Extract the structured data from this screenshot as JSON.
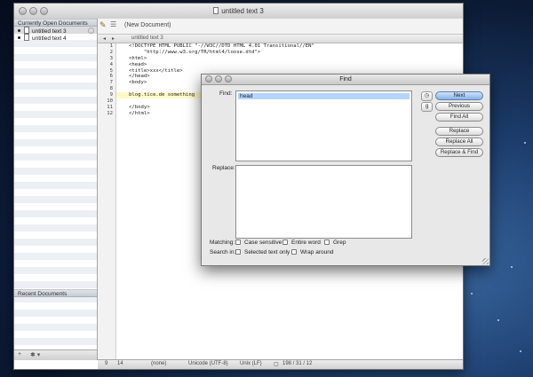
{
  "window": {
    "title": "untitled text 3"
  },
  "sidebar": {
    "open_header": "Currently Open Documents",
    "items": [
      {
        "label": "untitled text 3",
        "selected": true
      },
      {
        "label": "untitled text 4",
        "selected": false
      }
    ],
    "recent_header": "Recent Documents",
    "footer_add": "+",
    "footer_gear": "✱ ▾"
  },
  "toolbar": {
    "doc_label": "(New Document)"
  },
  "navbar": {
    "doc_name": "untitled text 3",
    "back": "◂",
    "forward": "▸"
  },
  "editor": {
    "line_numbers": [
      "1",
      "2",
      "3",
      "4",
      "5",
      "6",
      "7",
      "8",
      "9",
      "10",
      "11",
      "12"
    ],
    "lines": [
      "<!DOCTYPE HTML PUBLIC \"-//W3C//DTD HTML 4.01 Transitional//EN\"",
      "     \"http://www.w3.org/TR/html4/loose.dtd\">",
      "<html>",
      "<head>",
      "<title>xxx</title>",
      "</head>",
      "<body>",
      "",
      "blog.tice.de something",
      "",
      "</body>",
      "</html>"
    ]
  },
  "status": {
    "pos": "9",
    "col": "14",
    "lang": "(none)",
    "encoding": "Unicode (UTF-8)",
    "line_endings": "Unix (LF)",
    "counts": "198 / 31 / 12"
  },
  "find": {
    "title": "Find",
    "find_label": "Find:",
    "find_value": "head",
    "replace_label": "Replace:",
    "buttons": [
      "Next",
      "Previous",
      "Find All",
      "Replace",
      "Replace All",
      "Replace & Find"
    ],
    "matching_label": "Matching:",
    "case_sensitive": "Case sensitive",
    "entire_word": "Entire word",
    "grep": "Grep",
    "search_in_label": "Search in:",
    "selected_text_only": "Selected text only",
    "wrap_around": "Wrap around"
  }
}
